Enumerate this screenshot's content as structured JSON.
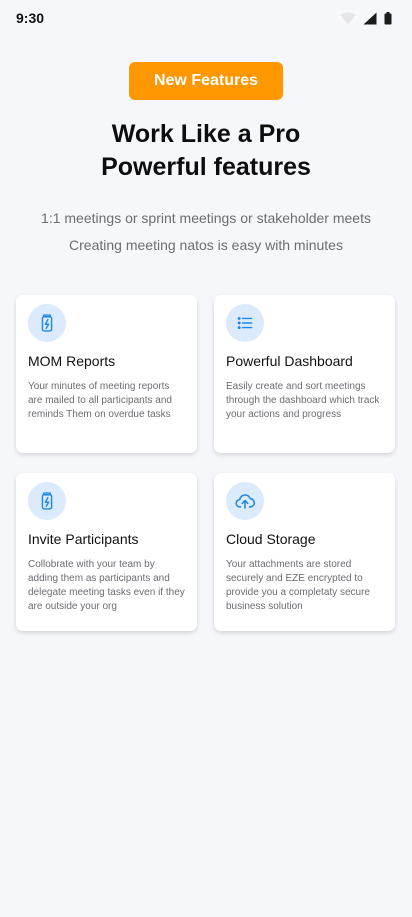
{
  "status_bar": {
    "time": "9:30",
    "icons": [
      "wifi-icon",
      "signal-icon",
      "battery-icon"
    ]
  },
  "badge": {
    "label": "New Features",
    "color": "#FF9800"
  },
  "headline": {
    "line1": "Work Like a Pro",
    "line2": "Powerful features"
  },
  "subtext": {
    "line1": "1:1 meetings or sprint meetings or stakeholder meets",
    "line2": "Creating meeting natos is easy with minutes"
  },
  "colors": {
    "accent": "#FF9800",
    "icon_blue": "#1E88E5",
    "icon_bg": "#DBEAFD",
    "background": "#F6F7FA"
  },
  "features": [
    {
      "icon": "battery-charging-icon",
      "title": "MOM Reports",
      "description": "Your minutes of meeting reports are mailed to all participants and reminds Them on overdue tasks"
    },
    {
      "icon": "list-icon",
      "title": "Powerful Dashboard",
      "description": "Easily create and sort meetings through the dashboard which track your actions and progress"
    },
    {
      "icon": "battery-charging-icon",
      "title": "Invite Participants",
      "description": "Collobrate with your team by adding them as participants and delegate meeting tasks even if they are outside your org"
    },
    {
      "icon": "cloud-upload-icon",
      "title": "Cloud Storage",
      "description": "Your attachments are stored securely and EZE encrypted to provide you a completaty secure business solution"
    }
  ]
}
